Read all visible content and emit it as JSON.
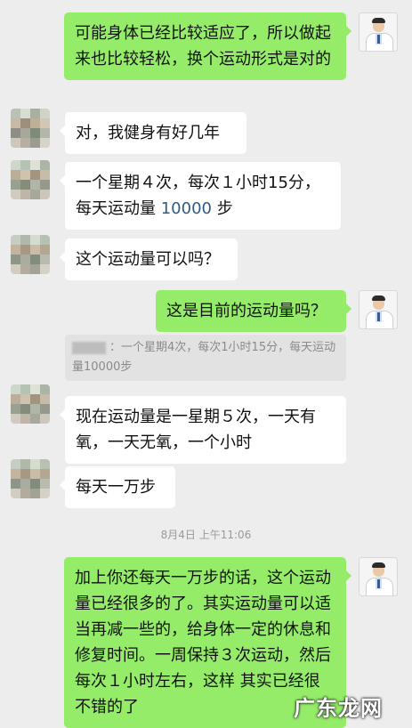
{
  "messages": [
    {
      "side": "out",
      "text": "可能身体已经比较适应了，所以做起来也比较轻松，换个运动形式是对的"
    },
    {
      "side": "in",
      "text": "对，我健身有好几年"
    },
    {
      "side": "in",
      "text_before": "一个星期４次，每次１小时15分，每天运动量 ",
      "highlight": "10000",
      "text_after": " 步"
    },
    {
      "side": "in",
      "text": "这个运动量可以吗？"
    },
    {
      "side": "out",
      "text": "这是目前的运动量吗？"
    },
    {
      "side": "in",
      "text": "现在运动量是一星期５次，一天有氧，一天无氧，一个小时"
    },
    {
      "side": "in",
      "text": "每天一万步"
    },
    {
      "side": "out",
      "text": "加上你还每天一万步的话，这个运动量已经很多的了。其实运动量可以适当再减一些的，给身体一定的休息和修复时间。一周保持３次运动，然后每次１小时左右，这样 其实已经很不错的了"
    }
  ],
  "quote": {
    "text": "：一个星期4次，每次1小时15分，每天运动量10000步"
  },
  "timestamp": "8月4日 上午11:06",
  "watermark": "广东龙网",
  "colors": {
    "background": "#ededed",
    "outgoing": "#95ec69",
    "incoming": "#ffffff",
    "link": "#2f5b85"
  }
}
